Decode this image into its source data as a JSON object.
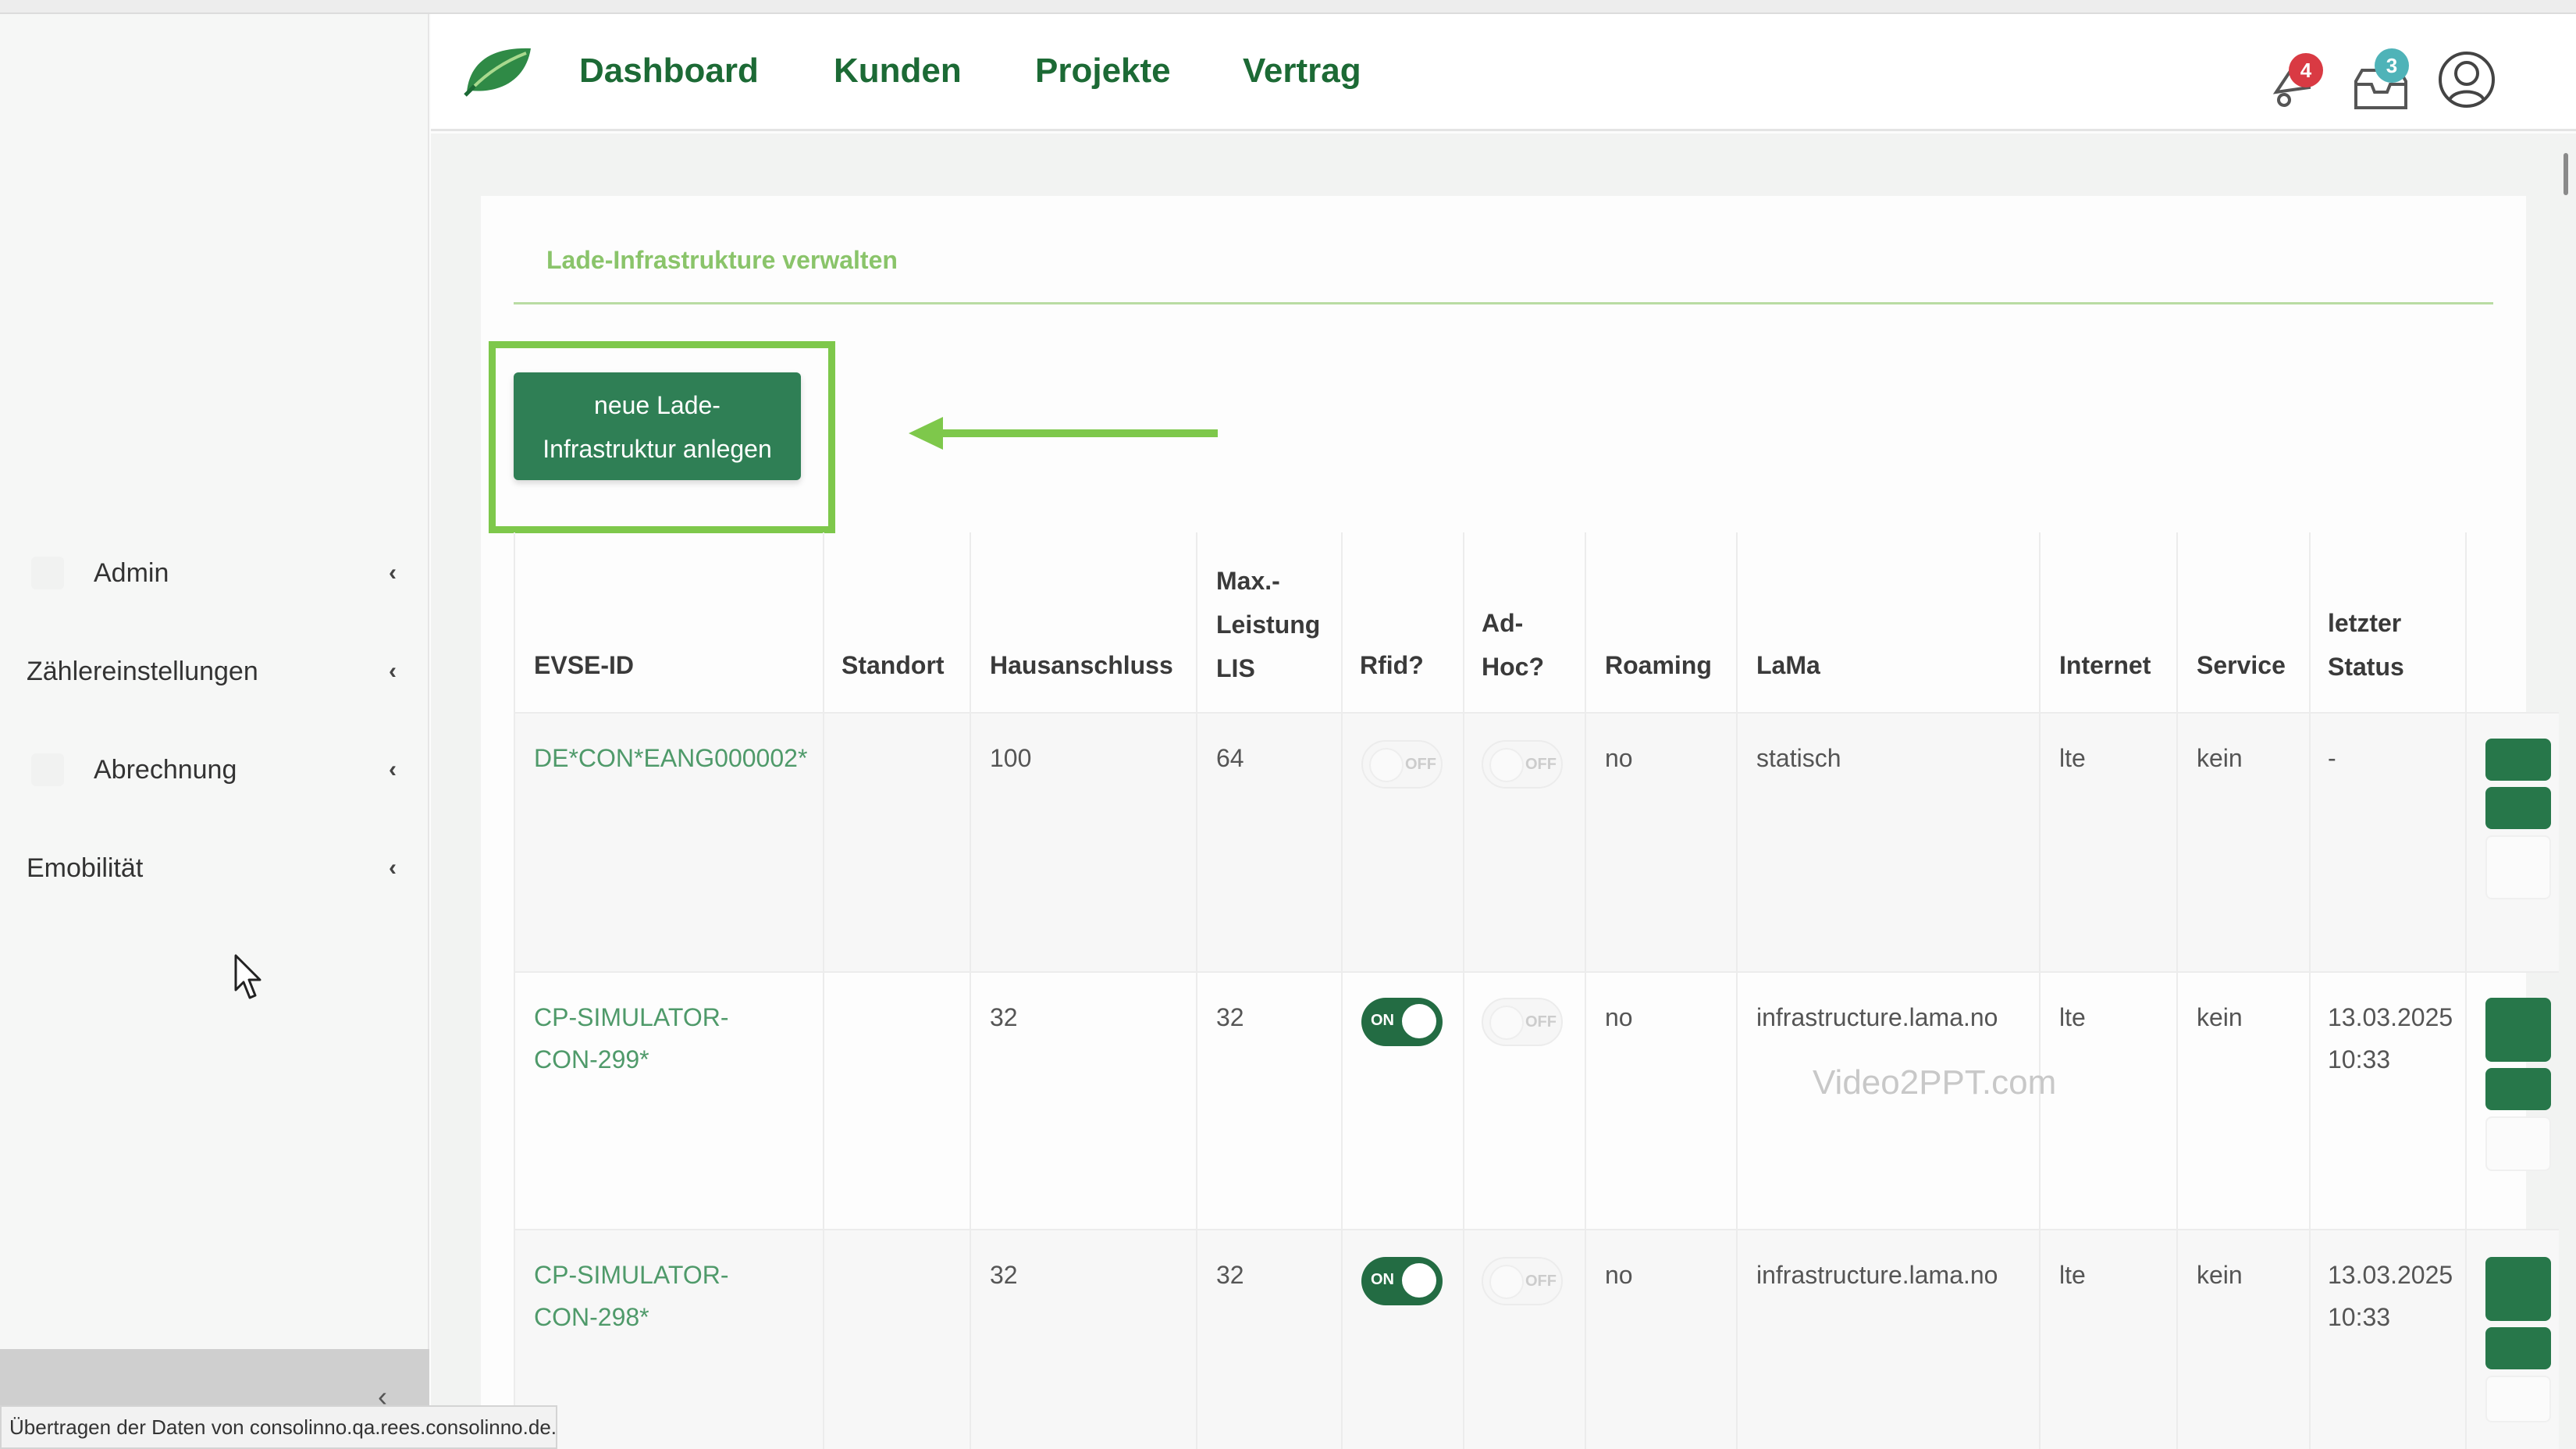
{
  "nav": {
    "links": [
      "Dashboard",
      "Kunden",
      "Projekte",
      "Vertrag"
    ],
    "notification_count": "4",
    "messages_count": "3"
  },
  "sidebar": {
    "items": [
      {
        "label": "Admin"
      },
      {
        "label": "Zählereinstellungen"
      },
      {
        "label": "Abrechnung"
      },
      {
        "label": "Emobilität"
      }
    ]
  },
  "page": {
    "title": "Lade-Infrastrukture verwalten",
    "new_button_line1": "neue Lade-",
    "new_button_line2": "Infrastruktur anlegen"
  },
  "table": {
    "headers": {
      "evse": "EVSE-ID",
      "standort": "Standort",
      "hausanschluss": "Hausanschluss",
      "max1": "Max.-",
      "max2": "Leistung",
      "max3": "LIS",
      "rfid": "Rfid?",
      "adhoc1": "Ad-",
      "adhoc2": "Hoc?",
      "roaming": "Roaming",
      "lama": "LaMa",
      "internet": "Internet",
      "service": "Service",
      "status1": "letzter",
      "status2": "Status"
    },
    "rows": [
      {
        "evse1": "DE*CON*EANG000002*",
        "evse2": "",
        "standort": "",
        "hausanschluss": "100",
        "max": "64",
        "rfid": "OFF",
        "adhoc": "OFF",
        "roaming": "no",
        "lama": "statisch",
        "internet": "lte",
        "service": "kein",
        "status1": "-",
        "status2": ""
      },
      {
        "evse1": "CP-SIMULATOR-",
        "evse2": "CON-299*",
        "standort": "",
        "hausanschluss": "32",
        "max": "32",
        "rfid": "ON",
        "adhoc": "OFF",
        "roaming": "no",
        "lama": "infrastructure.lama.no",
        "internet": "lte",
        "service": "kein",
        "status1": "13.03.2025",
        "status2": "10:33"
      },
      {
        "evse1": "CP-SIMULATOR-",
        "evse2": "CON-298*",
        "standort": "",
        "hausanschluss": "32",
        "max": "32",
        "rfid": "ON",
        "adhoc": "OFF",
        "roaming": "no",
        "lama": "infrastructure.lama.no",
        "internet": "lte",
        "service": "kein",
        "status1": "13.03.2025",
        "status2": "10:33"
      }
    ]
  },
  "watermark": "Video2PPT.com",
  "statusbar": "Übertragen der Daten von consolinno.qa.rees.consolinno.de...",
  "colors": {
    "brand_green": "#1c6a35",
    "button_green": "#2f7f55",
    "highlight": "#7ec84b",
    "title_green": "#8ac46a"
  }
}
